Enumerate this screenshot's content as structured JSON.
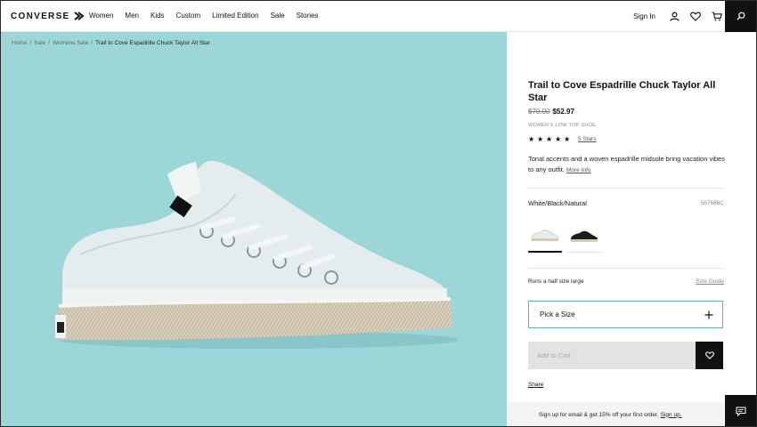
{
  "brand": {
    "logo_text": "CONVERSE"
  },
  "nav": {
    "items": [
      "Women",
      "Men",
      "Kids",
      "Custom",
      "Limited Edition",
      "Sale",
      "Stories"
    ],
    "sign_in": "Sign In"
  },
  "breadcrumb": {
    "items": [
      "Home",
      "Sale",
      "Womens Sale"
    ],
    "current": "Trail to Cove Espadrille Chuck Taylor All Star",
    "separator": "/"
  },
  "product": {
    "title": "Trail to Cove Espadrille Chuck Taylor All Star",
    "price_original": "$70.00",
    "price_sale": "$52.97",
    "category": "WOMEN'S LOW TOP SHOE",
    "rating_stars": 5,
    "rating_link": "5 Stars",
    "description": "Tonal accents and a woven espadrille midsole bring vacation vibes to any outfit.",
    "more_info": "More Info",
    "color_name": "White/Black/Natural",
    "sku": "567686C",
    "fit_note": "Runs a half size large",
    "size_guide": "Size Guide",
    "pick_size": "Pick a Size",
    "add_to_cart": "Add to Cart",
    "share": "Share"
  },
  "signup": {
    "text": "Sign up for email & get 15% off your first order.",
    "link": "Sign up."
  },
  "colors": {
    "hero_bg": "#9dd6d9",
    "accent_border": "#5fb2b8",
    "dark": "#111111"
  },
  "icons": [
    "arrow-logo-icon",
    "user-icon",
    "heart-icon",
    "cart-icon",
    "search-icon",
    "plus-icon",
    "chat-icon",
    "star-icon"
  ]
}
